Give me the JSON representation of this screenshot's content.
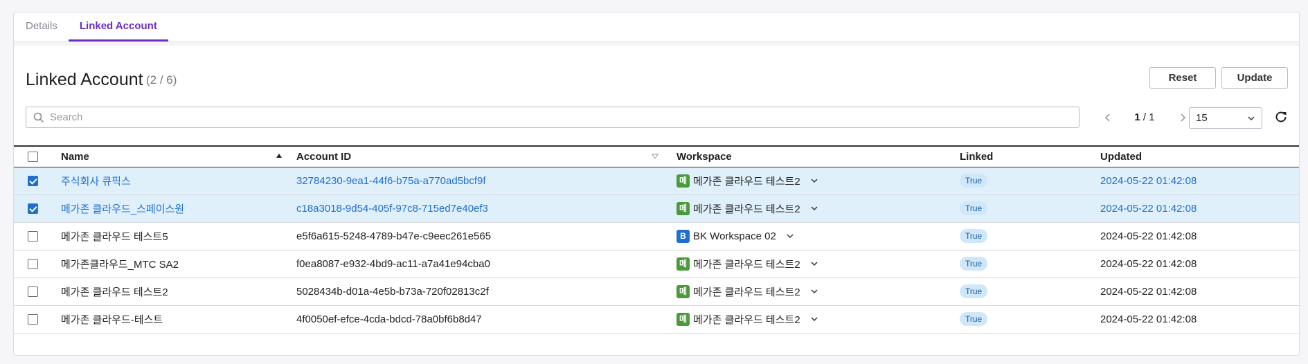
{
  "tabs": [
    {
      "label": "Details",
      "active": false
    },
    {
      "label": "Linked Account",
      "active": true
    }
  ],
  "header": {
    "title": "Linked Account",
    "count": "(2 / 6)",
    "reset_label": "Reset",
    "update_label": "Update"
  },
  "search": {
    "placeholder": "Search",
    "value": ""
  },
  "pager": {
    "current": "1",
    "total": "/ 1",
    "page_size": "15"
  },
  "columns": {
    "name": "Name",
    "account_id": "Account ID",
    "workspace": "Workspace",
    "linked": "Linked",
    "updated": "Updated"
  },
  "rows": [
    {
      "checked": true,
      "name": "주식회사 큐픽스",
      "account_id": "32784230-9ea1-44f6-b75a-a770ad5bcf9f",
      "ws_badge": "메",
      "ws_color": "#4a9a3a",
      "workspace": "메가존 클라우드 테스트2",
      "linked": "True",
      "updated": "2024-05-22 01:42:08"
    },
    {
      "checked": true,
      "name": "메가존 클라우드_스페이스원",
      "account_id": "c18a3018-9d54-405f-97c8-715ed7e40ef3",
      "ws_badge": "메",
      "ws_color": "#4a9a3a",
      "workspace": "메가존 클라우드 테스트2",
      "linked": "True",
      "updated": "2024-05-22 01:42:08"
    },
    {
      "checked": false,
      "name": "메가존 클라우드 테스트5",
      "account_id": "e5f6a615-5248-4789-b47e-c9eec261e565",
      "ws_badge": "B",
      "ws_color": "#1f6fd1",
      "workspace": "BK Workspace 02",
      "linked": "True",
      "updated": "2024-05-22 01:42:08"
    },
    {
      "checked": false,
      "name": "메가존클라우드_MTC SA2",
      "account_id": "f0ea8087-e932-4bd9-ac11-a7a41e94cba0",
      "ws_badge": "메",
      "ws_color": "#4a9a3a",
      "workspace": "메가존 클라우드 테스트2",
      "linked": "True",
      "updated": "2024-05-22 01:42:08"
    },
    {
      "checked": false,
      "name": "메가존 클라우드 테스트2",
      "account_id": "5028434b-d01a-4e5b-b73a-720f02813c2f",
      "ws_badge": "메",
      "ws_color": "#4a9a3a",
      "workspace": "메가존 클라우드 테스트2",
      "linked": "True",
      "updated": "2024-05-22 01:42:08"
    },
    {
      "checked": false,
      "name": "메가존 클라우드-테스트",
      "account_id": "4f0050ef-efce-4cda-bdcd-78a0bf6b8d47",
      "ws_badge": "메",
      "ws_color": "#4a9a3a",
      "workspace": "메가존 클라우드 테스트2",
      "linked": "True",
      "updated": "2024-05-22 01:42:08"
    }
  ],
  "colors": {
    "accent": "#6a2fc2",
    "link": "#1f6fd1",
    "selected_row": "#dff0fb"
  }
}
